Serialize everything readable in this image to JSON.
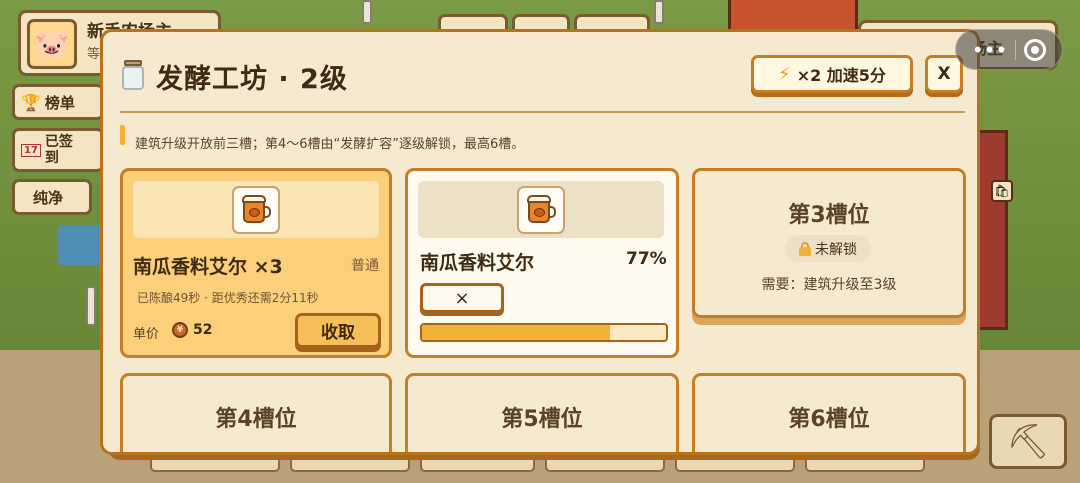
{
  "hud": {
    "profile_name": "新手农场主",
    "profile_sub": "等",
    "leaderboard_label": "榜单",
    "checkin_label": "已签到",
    "checkin_day": "17",
    "pure_label": "纯净",
    "owner_label": "场主"
  },
  "modal": {
    "title": "发酵工坊 · 2级",
    "speed_up_label": "×2 加速5分",
    "close_label": "X",
    "hint": "建筑升级开放前三槽；第4～6槽由“发酵扩容”逐级解锁，最高6槽。"
  },
  "slots": {
    "slot1": {
      "name": "南瓜香料艾尔 ×3",
      "quality": "普通",
      "info": "已陈酿49秒 · 距优秀还需2分11秒",
      "price_label": "单价",
      "price": "52",
      "collect_label": "收取"
    },
    "slot2": {
      "name": "南瓜香料艾尔",
      "percent_text": "77%",
      "progress": 0.77,
      "cancel_label": "×"
    },
    "slot3": {
      "title": "第3槽位",
      "lock_label": "未解锁",
      "requirement": "需要：建筑升级至3级"
    },
    "slot4": {
      "title": "第4槽位"
    },
    "slot5": {
      "title": "第5槽位"
    },
    "slot6": {
      "title": "第6槽位"
    }
  },
  "colors": {
    "accent": "#f2b23a",
    "border": "#c57e25",
    "panel": "#f5e9cf",
    "ready_slot": "#fccf7b"
  },
  "icons": {
    "speed": "lightning-icon",
    "product": "pumpkin-ale-mug-icon",
    "coin": "coin-icon",
    "lock": "lock-icon",
    "tool": "pickaxe-icon"
  }
}
